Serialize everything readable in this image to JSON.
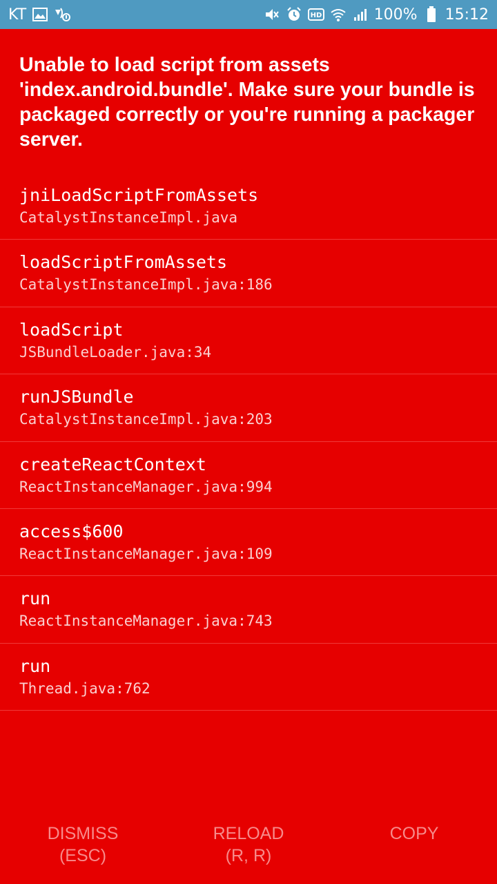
{
  "status_bar": {
    "carrier": "KT",
    "icons_left": [
      "gallery-icon",
      "wifi-call-icon"
    ],
    "icons_right": [
      "mute-icon",
      "alarm-icon",
      "hd-icon",
      "wifi-icon",
      "signal-icon"
    ],
    "battery": "100%",
    "time": "15:12",
    "background": "#4f9ac1"
  },
  "error": {
    "title": "Unable to load script from assets 'index.android.bundle'. Make sure your bundle is packaged correctly or you're running a packager server.",
    "background": "#e60000"
  },
  "stack": [
    {
      "method": "jniLoadScriptFromAssets",
      "file": "CatalystInstanceImpl.java"
    },
    {
      "method": "loadScriptFromAssets",
      "file": "CatalystInstanceImpl.java:186"
    },
    {
      "method": "loadScript",
      "file": "JSBundleLoader.java:34"
    },
    {
      "method": "runJSBundle",
      "file": "CatalystInstanceImpl.java:203"
    },
    {
      "method": "createReactContext",
      "file": "ReactInstanceManager.java:994"
    },
    {
      "method": "access$600",
      "file": "ReactInstanceManager.java:109"
    },
    {
      "method": "run",
      "file": "ReactInstanceManager.java:743"
    },
    {
      "method": "run",
      "file": "Thread.java:762"
    }
  ],
  "buttons": {
    "dismiss": {
      "line1": "DISMISS",
      "line2": "(ESC)"
    },
    "reload": {
      "line1": "RELOAD",
      "line2": "(R, R)"
    },
    "copy": {
      "line1": "COPY"
    }
  }
}
